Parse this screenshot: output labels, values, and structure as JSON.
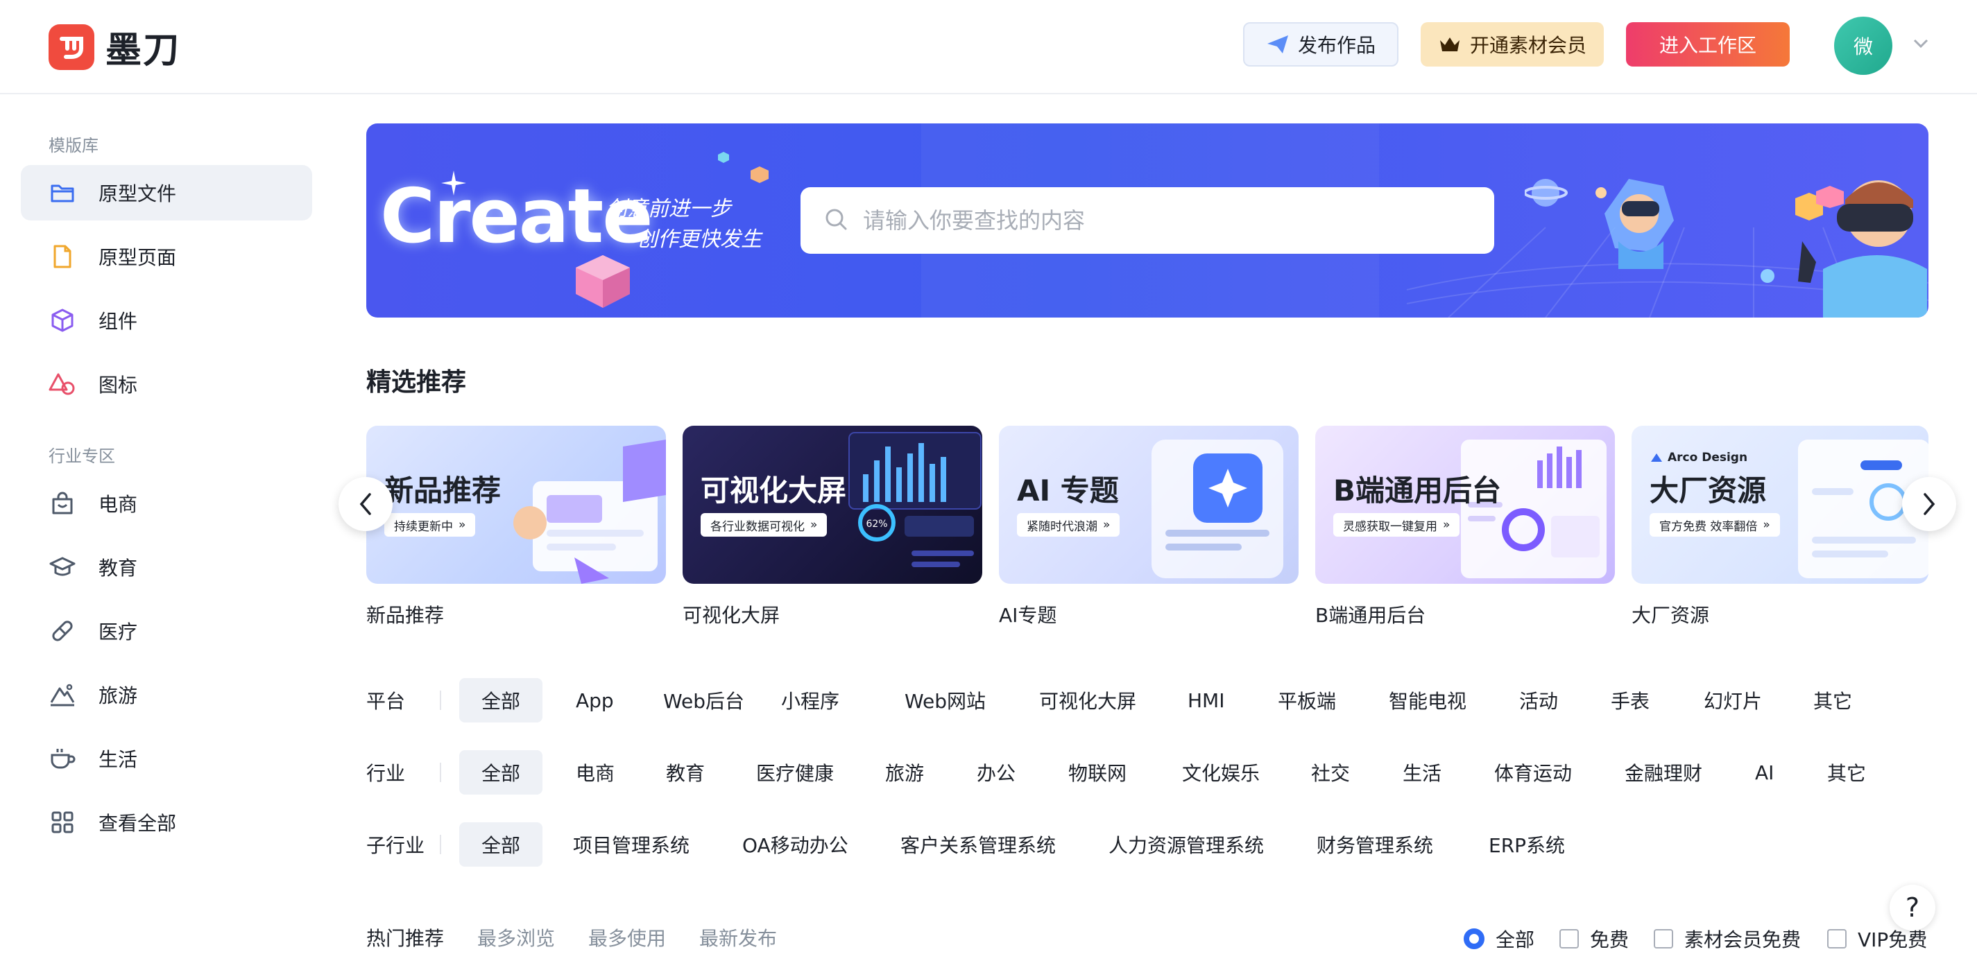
{
  "brand": {
    "name": "墨刀"
  },
  "header": {
    "publish_label": "发布作品",
    "vip_label": "开通素材会员",
    "enter_label": "进入工作区",
    "avatar_text": "微"
  },
  "sidebar": {
    "group1": "模版库",
    "group2": "行业专区",
    "items": [
      {
        "label": "原型文件",
        "icon": "folder-icon"
      },
      {
        "label": "原型页面",
        "icon": "file-icon"
      },
      {
        "label": "组件",
        "icon": "cube-icon"
      },
      {
        "label": "图标",
        "icon": "shapes-icon"
      },
      {
        "label": "电商",
        "icon": "shopping-bag-icon"
      },
      {
        "label": "教育",
        "icon": "graduation-cap-icon"
      },
      {
        "label": "医疗",
        "icon": "pill-icon"
      },
      {
        "label": "旅游",
        "icon": "mountain-icon"
      },
      {
        "label": "生活",
        "icon": "coffee-cup-icon"
      },
      {
        "label": "查看全部",
        "icon": "grid-icon"
      }
    ]
  },
  "banner": {
    "title": "Create",
    "slogan_line1": "创意前进一步",
    "slogan_line2": "创作更快发生",
    "search_placeholder": "请输入你要查找的内容"
  },
  "featured": {
    "title": "精选推荐",
    "cards": [
      {
        "heading": "新品推荐",
        "tag": "持续更新中",
        "caption": "新品推荐"
      },
      {
        "heading": "可视化大屏",
        "tag": "各行业数据可视化",
        "caption": "可视化大屏",
        "gauge_text": "62%"
      },
      {
        "heading": "AI 专题",
        "tag": "紧随时代浪潮",
        "caption": "AI专题"
      },
      {
        "heading": "B端通用后台",
        "tag": "灵感获取一键复用",
        "caption": "B端通用后台"
      },
      {
        "heading": "大厂资源",
        "tag": "官方免费 效率翻倍",
        "caption": "大厂资源",
        "badge": "Arco Design"
      }
    ]
  },
  "filters": {
    "platform": {
      "label": "平台",
      "options": [
        "全部",
        "App",
        "Web后台",
        "小程序",
        "Web网站",
        "可视化大屏",
        "HMI",
        "平板端",
        "智能电视",
        "活动",
        "手表",
        "幻灯片",
        "其它"
      ]
    },
    "industry": {
      "label": "行业",
      "options": [
        "全部",
        "电商",
        "教育",
        "医疗健康",
        "旅游",
        "办公",
        "物联网",
        "文化娱乐",
        "社交",
        "生活",
        "体育运动",
        "金融理财",
        "AI",
        "其它"
      ]
    },
    "sub_industry": {
      "label": "子行业",
      "options": [
        "全部",
        "项目管理系统",
        "OA移动办公",
        "客户关系管理系统",
        "人力资源管理系统",
        "财务管理系统",
        "ERP系统"
      ]
    }
  },
  "sort": {
    "tabs": [
      "热门推荐",
      "最多浏览",
      "最多使用",
      "最新发布"
    ],
    "price_filters": [
      "全部",
      "免费",
      "素材会员免费",
      "VIP免费"
    ]
  },
  "help": {
    "label": "?"
  },
  "colors": {
    "primary": "#2f6cf6",
    "brand_red": "#f04b3e",
    "banner": "#4a57ef"
  }
}
